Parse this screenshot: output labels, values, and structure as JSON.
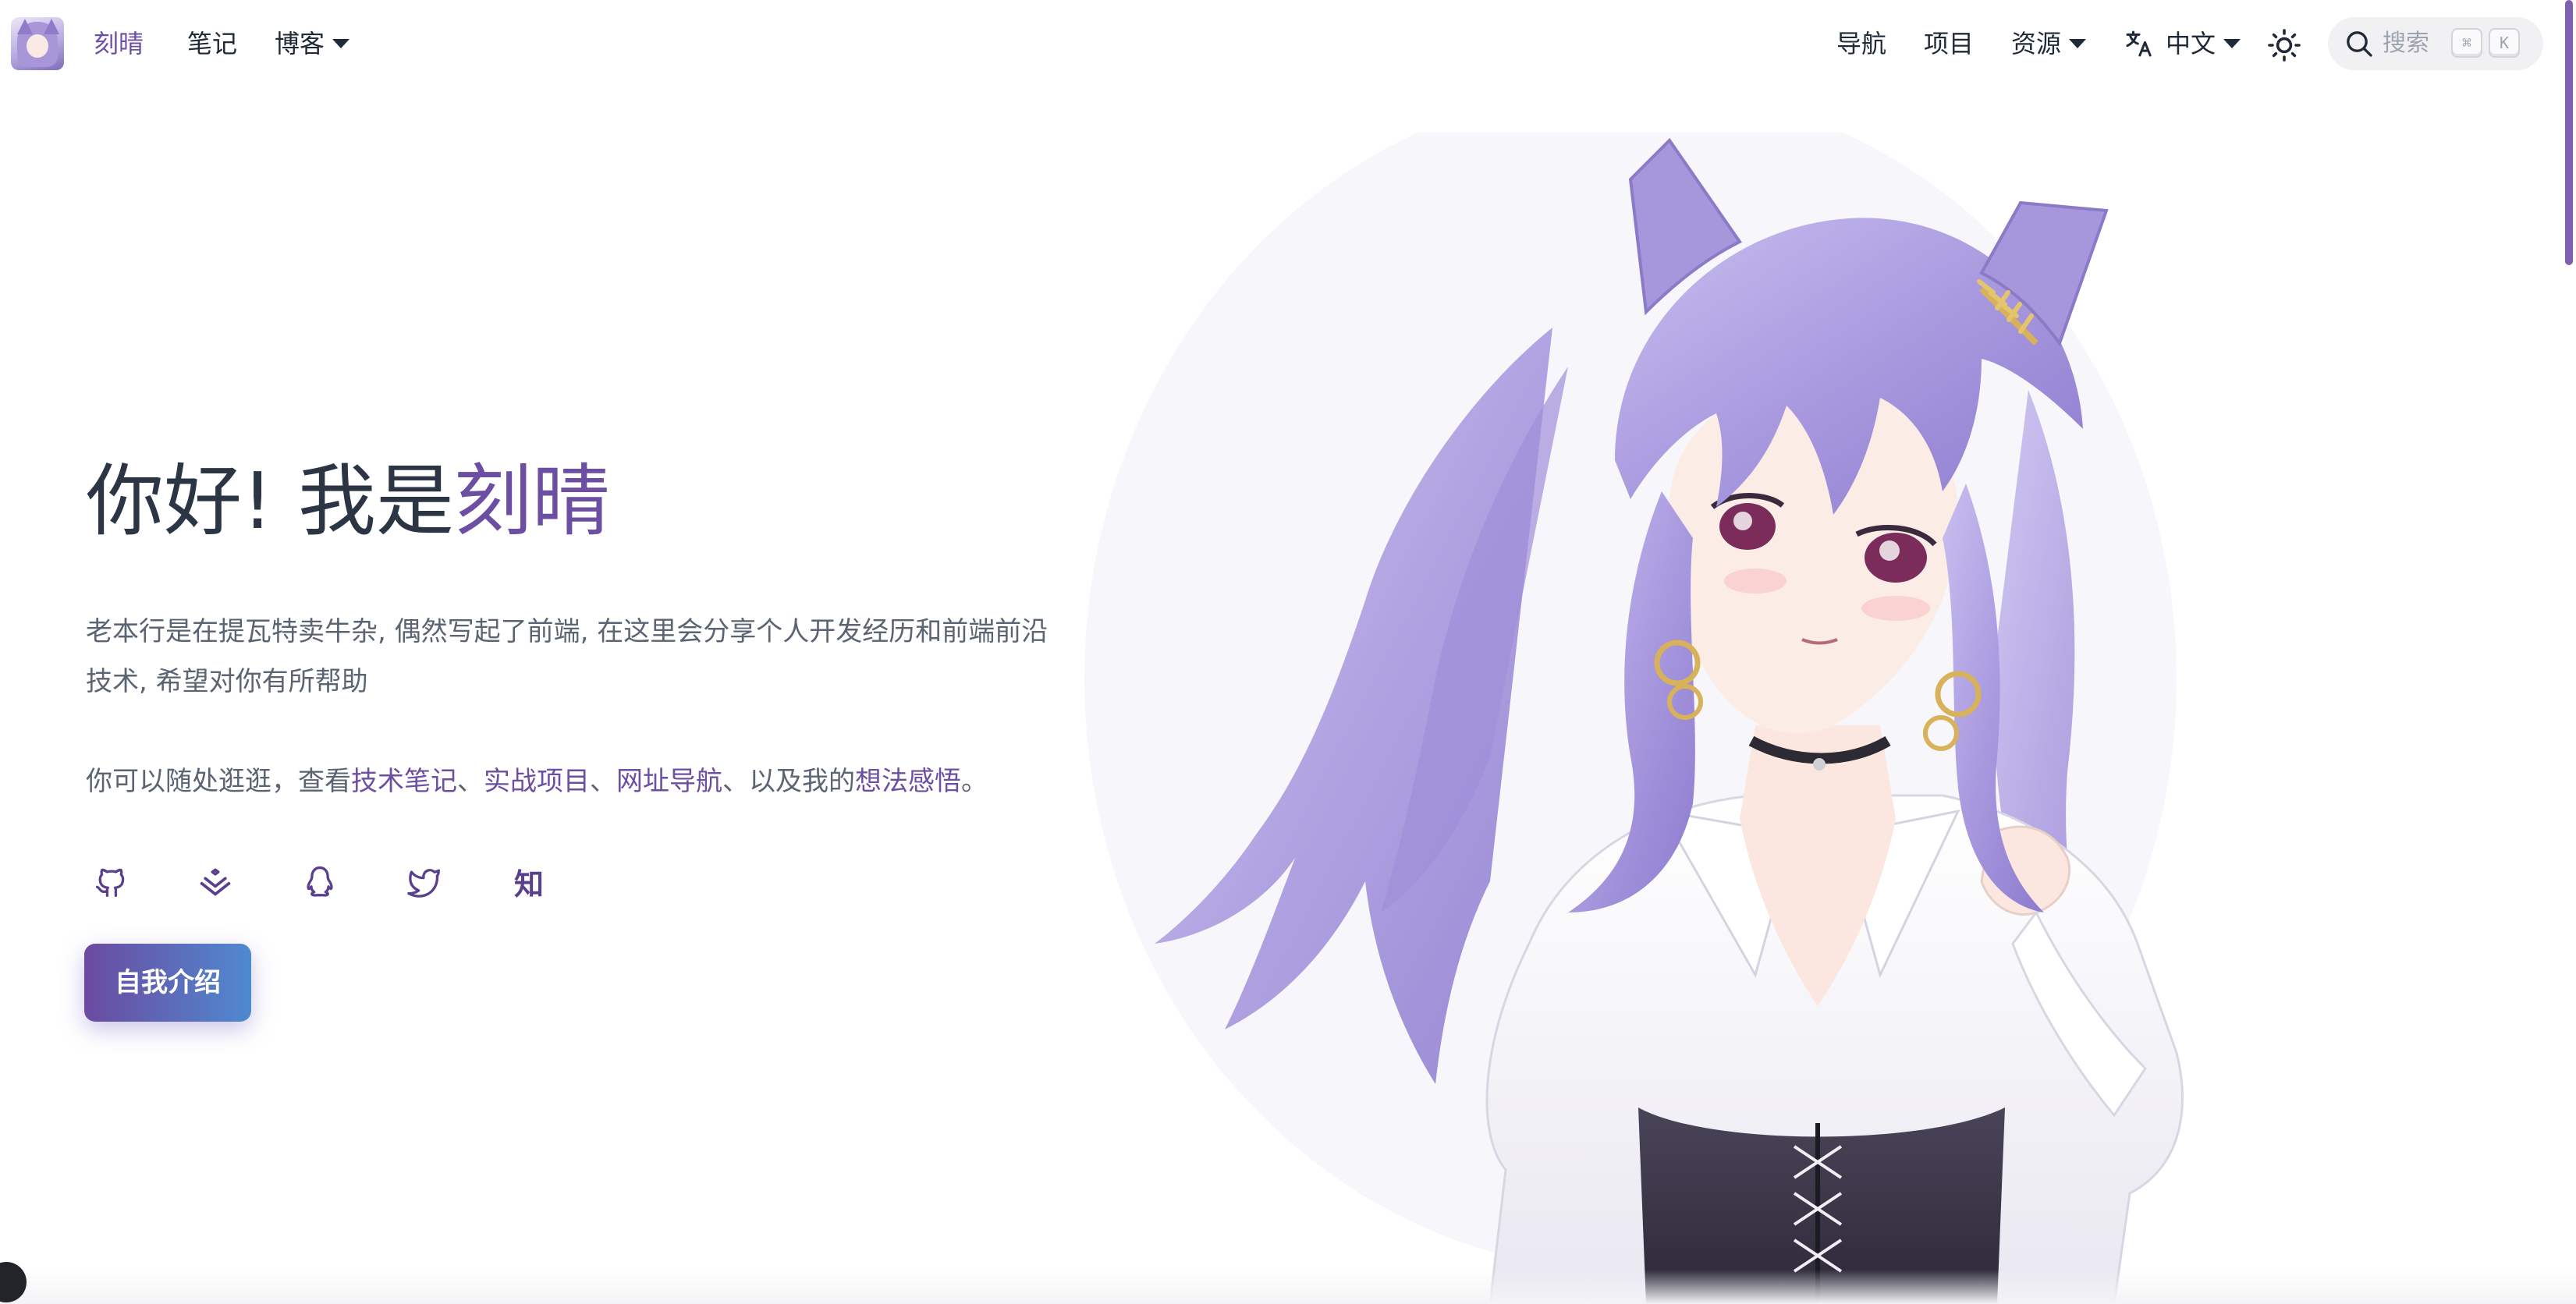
{
  "navbar": {
    "brand": "刻晴",
    "notes": "笔记",
    "blog": "博客",
    "nav": "导航",
    "projects": "项目",
    "resources": "资源",
    "language": "中文",
    "search_placeholder": "搜索",
    "kbd_cmd": "⌘",
    "kbd_k": "K"
  },
  "hero": {
    "title_prefix": "你好! 我是",
    "title_name": "刻晴",
    "description": "老本行是在提瓦特卖牛杂, 偶然写起了前端, 在这里会分享个人开发经历和前端前沿技术, 希望对你有所帮助",
    "links_intro": "你可以随处逛逛，查看",
    "link_notes": "技术笔记",
    "sep": "、",
    "link_projects": "实战项目",
    "link_nav": "网址导航",
    "links_and": "、以及我的",
    "link_thoughts": "想法感悟",
    "links_end": "。",
    "socials": [
      "github-icon",
      "juejin-icon",
      "qq-icon",
      "twitter-icon",
      "zhihu-icon"
    ],
    "zhihu_label": "知",
    "button_label": "自我介绍"
  },
  "colors": {
    "accent": "#6c4ea2",
    "button_gradient_start": "#6b4aa0",
    "button_gradient_end": "#4f89d0",
    "text": "#2c3544",
    "muted": "#5b6473"
  }
}
